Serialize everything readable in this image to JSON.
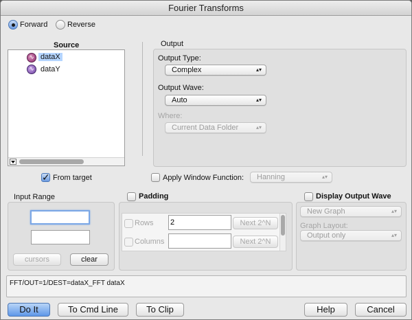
{
  "window": {
    "title": "Fourier Transforms"
  },
  "direction": {
    "forward_label": "Forward",
    "reverse_label": "Reverse",
    "selected": "Forward"
  },
  "source": {
    "heading": "Source",
    "items": [
      {
        "label": "dataX",
        "icon": "wave-icon",
        "selected": true
      },
      {
        "label": "dataY",
        "icon": "wave-icon",
        "selected": false
      }
    ],
    "from_target_label": "From target",
    "from_target_checked": true
  },
  "output": {
    "heading": "Output",
    "type_label": "Output Type:",
    "type_value": "Complex",
    "wave_label": "Output Wave:",
    "wave_value": "Auto",
    "where_label": "Where:",
    "where_value": "Current Data Folder"
  },
  "window_function": {
    "label": "Apply Window Function:",
    "checked": false,
    "value": "Hanning"
  },
  "input_range": {
    "heading": "Input Range",
    "start_value": "",
    "end_value": "",
    "cursors_label": "cursors",
    "clear_label": "clear"
  },
  "padding": {
    "label": "Padding",
    "checked": false,
    "rows_label": "Rows",
    "rows_value": "2",
    "columns_label": "Columns",
    "columns_value": "",
    "next_label": "Next 2^N"
  },
  "display_output": {
    "label": "Display Output Wave",
    "checked": false,
    "graph_value": "New Graph",
    "layout_label": "Graph Layout:",
    "layout_value": "Output only"
  },
  "command": {
    "text": "FFT/OUT=1/DEST=dataX_FFT dataX"
  },
  "buttons": {
    "do_it": "Do It",
    "to_cmd_line": "To Cmd Line",
    "to_clip": "To Clip",
    "help": "Help",
    "cancel": "Cancel"
  },
  "colors": {
    "accent": "#6d9be0",
    "selection": "#b5d5ff"
  }
}
